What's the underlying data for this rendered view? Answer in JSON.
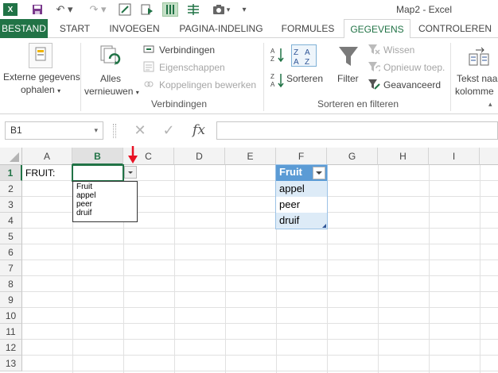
{
  "window": {
    "title": "Map2 - Excel"
  },
  "tabs": {
    "file": "BESTAND",
    "items": [
      "START",
      "INVOEGEN",
      "PAGINA-INDELING",
      "FORMULES",
      "GEGEVENS",
      "CONTROLEREN"
    ],
    "active": "GEGEVENS"
  },
  "ribbon": {
    "external_line1": "Externe gegevens",
    "external_line2": "ophalen",
    "refresh_line1": "Alles",
    "refresh_line2": "vernieuwen",
    "connections": "Verbindingen",
    "properties": "Eigenschappen",
    "edit_links": "Koppelingen bewerken",
    "group_connections": "Verbindingen",
    "sort": "Sorteren",
    "filter": "Filter",
    "clear": "Wissen",
    "reapply": "Opnieuw toep.",
    "advanced": "Geavanceerd",
    "group_sort_filter": "Sorteren en filteren",
    "text_to_cols_line1": "Tekst naar",
    "text_to_cols_line2": "kolomme"
  },
  "formula_bar": {
    "name_box": "B1",
    "fx": "fx",
    "value": ""
  },
  "grid": {
    "columns": [
      "A",
      "B",
      "C",
      "D",
      "E",
      "F",
      "G",
      "H",
      "I"
    ],
    "selected_column": "B",
    "rows": [
      "1",
      "2",
      "3",
      "4",
      "5",
      "6",
      "7",
      "8",
      "9",
      "10",
      "11",
      "12",
      "13"
    ],
    "selected_row": "1",
    "a1": "FRUIT:"
  },
  "dropdown": {
    "items": [
      "Fruit",
      "appel",
      "peer",
      "druif"
    ]
  },
  "table": {
    "header": "Fruit",
    "rows": [
      "appel",
      "peer",
      "druif"
    ],
    "colors": {
      "header": "#5b9bd5",
      "band": "#ddebf7"
    }
  },
  "colors": {
    "accent": "#217346",
    "arrow": "#e81123"
  }
}
